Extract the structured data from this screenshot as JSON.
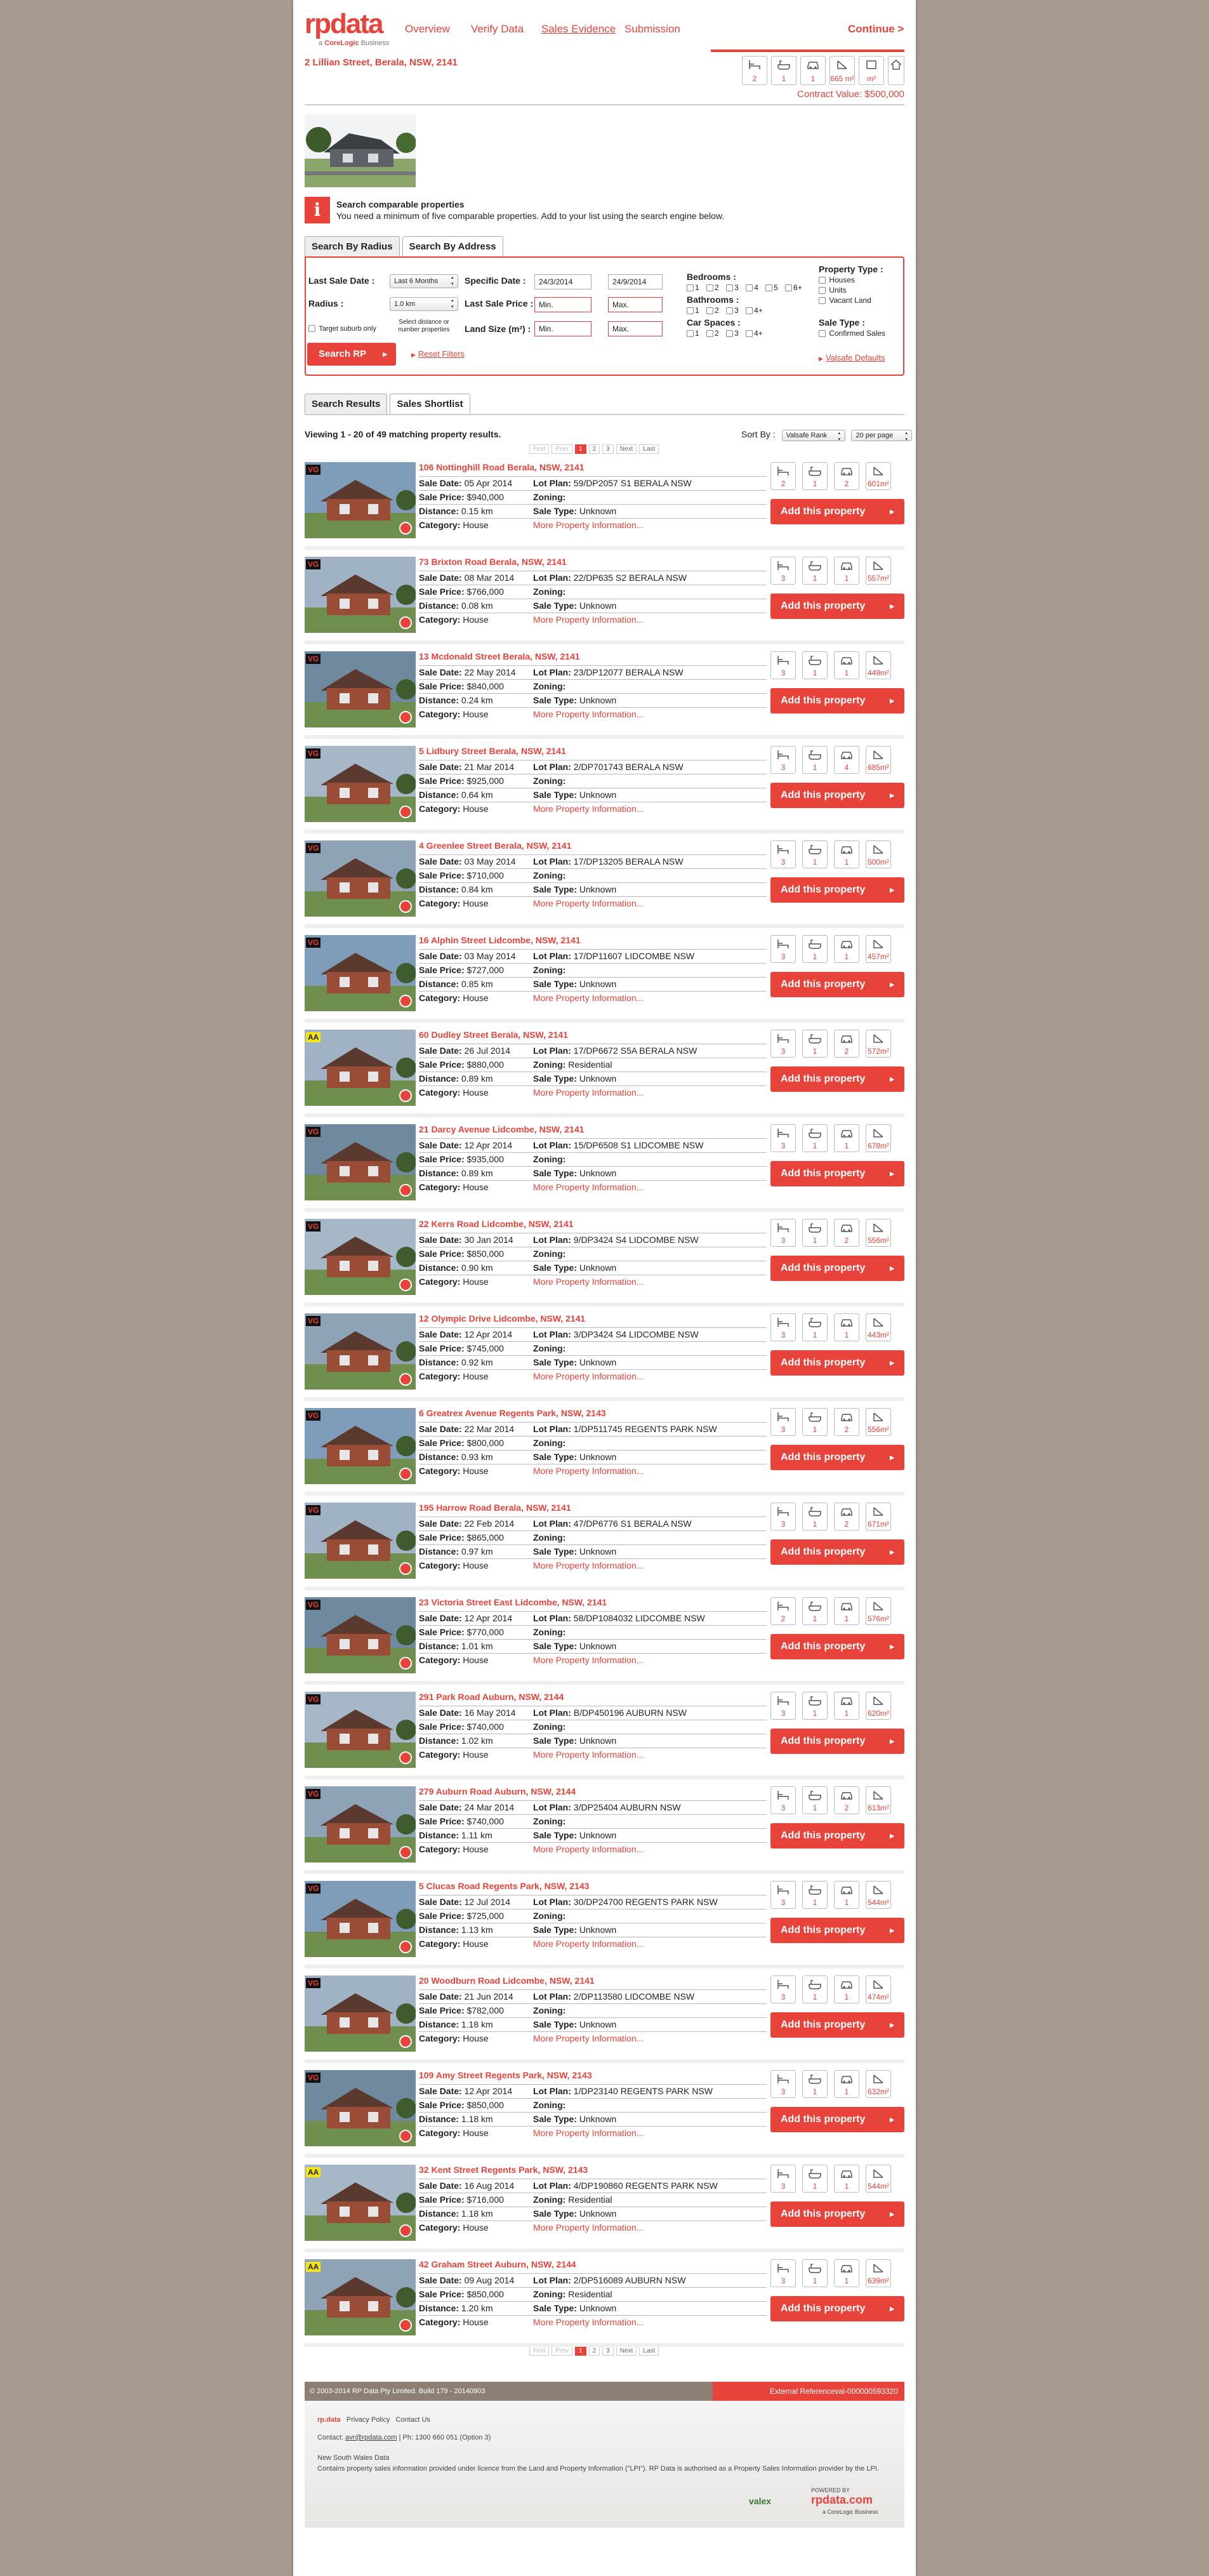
{
  "header": {
    "logo": "rpdata",
    "logo_tag_a": "a",
    "logo_tag_b": "CoreLogic",
    "logo_tag_c": "Business",
    "nav": [
      "Overview",
      "Verify Data",
      "Sales Evidence",
      "Submission"
    ],
    "active_nav": "Sales Evidence",
    "continue": "Continue >"
  },
  "subject": {
    "address": "2 Lillian Street, Berala, NSW, 2141",
    "beds": "2",
    "baths": "1",
    "cars": "1",
    "land": "665 m²",
    "floor": "m²",
    "contract_value": "Contract Value: $500,000"
  },
  "info": {
    "icon": "i",
    "title": "Search comparable properties",
    "text": "You need a minimum of five comparable properties. Add to your list using the search engine below."
  },
  "search": {
    "tabs": [
      "Search By Radius",
      "Search By Address"
    ],
    "last_sale_date_label": "Last Sale Date :",
    "last_sale_date_value": "Last 6 Months",
    "specific_date_label": "Specific Date :",
    "date_from": "24/3/2014",
    "date_to": "24/9/2014",
    "radius_label": "Radius :",
    "radius_value": "1.0 km",
    "last_sale_price_label": "Last Sale Price :",
    "price_min": "Min.",
    "price_max": "Max.",
    "target_suburb": "Target suburb only",
    "select_hint": "Select distance or number properties",
    "land_size_label": "Land Size (m²) :",
    "land_min": "Min.",
    "land_max": "Max.",
    "bedrooms_label": "Bedrooms :",
    "bedroom_opts": [
      "1",
      "2",
      "3",
      "4",
      "5",
      "6+"
    ],
    "bathrooms_label": "Bathrooms :",
    "bathroom_opts": [
      "1",
      "2",
      "3",
      "4+"
    ],
    "car_spaces_label": "Car Spaces :",
    "car_opts": [
      "1",
      "2",
      "3",
      "4+"
    ],
    "property_type_label": "Property Type :",
    "property_types": [
      "Houses",
      "Units",
      "Vacant Land"
    ],
    "sale_type_label": "Sale Type :",
    "sale_type_opt": "Confirmed Sales",
    "search_button": "Search RP",
    "reset": "Reset Filters",
    "valsafe_defaults": "Valsafe Defaults"
  },
  "results": {
    "tabs": [
      "Search Results",
      "Sales Shortlist"
    ],
    "viewing": "Viewing 1 - 20 of 49 matching property results.",
    "sort_label": "Sort By :",
    "sort_value": "Valsafe Rank",
    "per_page": "20 per page",
    "pager": [
      "First",
      "Prev",
      "1",
      "2",
      "3",
      "Next",
      "Last"
    ],
    "labels": {
      "sale_date": "Sale Date:",
      "sale_price": "Sale Price:",
      "distance": "Distance:",
      "category": "Category:",
      "lot_plan": "Lot Plan:",
      "zoning": "Zoning:",
      "sale_type": "Sale Type:",
      "more": "More Property Information...",
      "add": "Add this property"
    },
    "items": [
      {
        "badge": "VG",
        "address": "106 Nottinghill Road Berala, NSW, 2141",
        "sale_date": "05 Apr 2014",
        "sale_price": "$940,000",
        "distance": "0.15 km",
        "category": "House",
        "lot_plan": "59/DP2057 S1 BERALA NSW",
        "zoning": "",
        "sale_type": "Unknown",
        "beds": "2",
        "baths": "1",
        "cars": "2",
        "land": "601m²"
      },
      {
        "badge": "VG",
        "address": "73 Brixton Road Berala, NSW, 2141",
        "sale_date": "08 Mar 2014",
        "sale_price": "$766,000",
        "distance": "0.08 km",
        "category": "House",
        "lot_plan": "22/DP635 S2 BERALA NSW",
        "zoning": "",
        "sale_type": "Unknown",
        "beds": "3",
        "baths": "1",
        "cars": "1",
        "land": "557m²"
      },
      {
        "badge": "VG",
        "address": "13 Mcdonald Street Berala, NSW, 2141",
        "sale_date": "22 May 2014",
        "sale_price": "$840,000",
        "distance": "0.24 km",
        "category": "House",
        "lot_plan": "23/DP12077 BERALA NSW",
        "zoning": "",
        "sale_type": "Unknown",
        "beds": "3",
        "baths": "1",
        "cars": "1",
        "land": "449m²"
      },
      {
        "badge": "VG",
        "address": "5 Lidbury Street Berala, NSW, 2141",
        "sale_date": "21 Mar 2014",
        "sale_price": "$925,000",
        "distance": "0.64 km",
        "category": "House",
        "lot_plan": "2/DP701743 BERALA NSW",
        "zoning": "",
        "sale_type": "Unknown",
        "beds": "3",
        "baths": "1",
        "cars": "4",
        "land": "685m²"
      },
      {
        "badge": "VG",
        "address": "4 Greenlee Street Berala, NSW, 2141",
        "sale_date": "03 May 2014",
        "sale_price": "$710,000",
        "distance": "0.84 km",
        "category": "House",
        "lot_plan": "17/DP13205 BERALA NSW",
        "zoning": "",
        "sale_type": "Unknown",
        "beds": "3",
        "baths": "1",
        "cars": "1",
        "land": "500m²"
      },
      {
        "badge": "VG",
        "address": "16 Alphin Street Lidcombe, NSW, 2141",
        "sale_date": "03 May 2014",
        "sale_price": "$727,000",
        "distance": "0.85 km",
        "category": "House",
        "lot_plan": "17/DP11607 LIDCOMBE NSW",
        "zoning": "",
        "sale_type": "Unknown",
        "beds": "3",
        "baths": "1",
        "cars": "1",
        "land": "457m²"
      },
      {
        "badge": "AA",
        "address": "60 Dudley Street Berala, NSW, 2141",
        "sale_date": "26 Jul 2014",
        "sale_price": "$880,000",
        "distance": "0.89 km",
        "category": "House",
        "lot_plan": "17/DP6672 S5A BERALA NSW",
        "zoning": "Residential",
        "sale_type": "Unknown",
        "beds": "3",
        "baths": "1",
        "cars": "2",
        "land": "572m²"
      },
      {
        "badge": "VG",
        "address": "21 Darcy Avenue Lidcombe, NSW, 2141",
        "sale_date": "12 Apr 2014",
        "sale_price": "$935,000",
        "distance": "0.89 km",
        "category": "House",
        "lot_plan": "15/DP6508 S1 LIDCOMBE NSW",
        "zoning": "",
        "sale_type": "Unknown",
        "beds": "3",
        "baths": "1",
        "cars": "1",
        "land": "678m²"
      },
      {
        "badge": "VG",
        "address": "22 Kerrs Road Lidcombe, NSW, 2141",
        "sale_date": "30 Jan 2014",
        "sale_price": "$850,000",
        "distance": "0.90 km",
        "category": "House",
        "lot_plan": "9/DP3424 S4 LIDCOMBE NSW",
        "zoning": "",
        "sale_type": "Unknown",
        "beds": "3",
        "baths": "1",
        "cars": "2",
        "land": "556m²"
      },
      {
        "badge": "VG",
        "address": "12 Olympic Drive Lidcombe, NSW, 2141",
        "sale_date": "12 Apr 2014",
        "sale_price": "$745,000",
        "distance": "0.92 km",
        "category": "House",
        "lot_plan": "3/DP3424 S4 LIDCOMBE NSW",
        "zoning": "",
        "sale_type": "Unknown",
        "beds": "3",
        "baths": "1",
        "cars": "1",
        "land": "443m²"
      },
      {
        "badge": "VG",
        "address": "6 Greatrex Avenue Regents Park, NSW, 2143",
        "sale_date": "22 Mar 2014",
        "sale_price": "$800,000",
        "distance": "0.93 km",
        "category": "House",
        "lot_plan": "1/DP511745 REGENTS PARK NSW",
        "zoning": "",
        "sale_type": "Unknown",
        "beds": "3",
        "baths": "1",
        "cars": "2",
        "land": "556m²"
      },
      {
        "badge": "VG",
        "address": "195 Harrow Road Berala, NSW, 2141",
        "sale_date": "22 Feb 2014",
        "sale_price": "$865,000",
        "distance": "0.97 km",
        "category": "House",
        "lot_plan": "47/DP6776 S1 BERALA NSW",
        "zoning": "",
        "sale_type": "Unknown",
        "beds": "3",
        "baths": "1",
        "cars": "2",
        "land": "671m²"
      },
      {
        "badge": "VG",
        "address": "23 Victoria Street East Lidcombe, NSW, 2141",
        "sale_date": "12 Apr 2014",
        "sale_price": "$770,000",
        "distance": "1.01 km",
        "category": "House",
        "lot_plan": "58/DP1084032 LIDCOMBE NSW",
        "zoning": "",
        "sale_type": "Unknown",
        "beds": "2",
        "baths": "1",
        "cars": "1",
        "land": "576m²"
      },
      {
        "badge": "VG",
        "address": "291 Park Road Auburn, NSW, 2144",
        "sale_date": "16 May 2014",
        "sale_price": "$740,000",
        "distance": "1.02 km",
        "category": "House",
        "lot_plan": "B/DP450196 AUBURN NSW",
        "zoning": "",
        "sale_type": "Unknown",
        "beds": "3",
        "baths": "1",
        "cars": "1",
        "land": "620m²"
      },
      {
        "badge": "VG",
        "address": "279 Auburn Road Auburn, NSW, 2144",
        "sale_date": "24 Mar 2014",
        "sale_price": "$740,000",
        "distance": "1.11 km",
        "category": "House",
        "lot_plan": "3/DP25404 AUBURN NSW",
        "zoning": "",
        "sale_type": "Unknown",
        "beds": "3",
        "baths": "1",
        "cars": "2",
        "land": "613m²"
      },
      {
        "badge": "VG",
        "address": "5 Clucas Road Regents Park, NSW, 2143",
        "sale_date": "12 Jul 2014",
        "sale_price": "$725,000",
        "distance": "1.13 km",
        "category": "House",
        "lot_plan": "30/DP24700 REGENTS PARK NSW",
        "zoning": "",
        "sale_type": "Unknown",
        "beds": "3",
        "baths": "1",
        "cars": "1",
        "land": "544m²"
      },
      {
        "badge": "VG",
        "address": "20 Woodburn Road Lidcombe, NSW, 2141",
        "sale_date": "21 Jun 2014",
        "sale_price": "$782,000",
        "distance": "1.18 km",
        "category": "House",
        "lot_plan": "2/DP113580 LIDCOMBE NSW",
        "zoning": "",
        "sale_type": "Unknown",
        "beds": "3",
        "baths": "1",
        "cars": "1",
        "land": "474m²"
      },
      {
        "badge": "VG",
        "address": "109 Amy Street Regents Park, NSW, 2143",
        "sale_date": "12 Apr 2014",
        "sale_price": "$850,000",
        "distance": "1.18 km",
        "category": "House",
        "lot_plan": "1/DP23140 REGENTS PARK NSW",
        "zoning": "",
        "sale_type": "Unknown",
        "beds": "3",
        "baths": "1",
        "cars": "1",
        "land": "632m²"
      },
      {
        "badge": "AA",
        "address": "32 Kent Street Regents Park, NSW, 2143",
        "sale_date": "16 Aug 2014",
        "sale_price": "$716,000",
        "distance": "1.18 km",
        "category": "House",
        "lot_plan": "4/DP190860 REGENTS PARK NSW",
        "zoning": "Residential",
        "sale_type": "Unknown",
        "beds": "3",
        "baths": "1",
        "cars": "1",
        "land": "544m²"
      },
      {
        "badge": "AA",
        "address": "42 Graham Street Auburn, NSW, 2144",
        "sale_date": "09 Aug 2014",
        "sale_price": "$850,000",
        "distance": "1.20 km",
        "category": "House",
        "lot_plan": "2/DP516089 AUBURN NSW",
        "zoning": "Residential",
        "sale_type": "Unknown",
        "beds": "3",
        "baths": "1",
        "cars": "1",
        "land": "639m²"
      }
    ]
  },
  "footer": {
    "copyright": "© 2003-2014 RP Data Pty Limited. Build 179 - 20140903",
    "external_ref_label": "External Reference:",
    "external_ref_value": "val-000000593320",
    "brand": "rp.data",
    "links": [
      "Privacy Policy",
      "Contact Us"
    ],
    "contact": "Contact:",
    "contact_email": "avr@rpdata.com",
    "phone": "|  Ph: 1300 660 051 (Option 3)",
    "nsw_title": "New South Wales Data",
    "nsw_text": "Contains property sales information provided under licence from the Land and Property Information (\"LPI\"). RP Data is authorised as a Property Sales Information provider by the LPI.",
    "valex": "valex",
    "powered_by": "POWERED BY",
    "powered_brand": "rpdata.com",
    "corelogic": "a CoreLogic Business"
  },
  "colors": {
    "accent": "#e8433a",
    "page_bg": "#a89b90"
  }
}
